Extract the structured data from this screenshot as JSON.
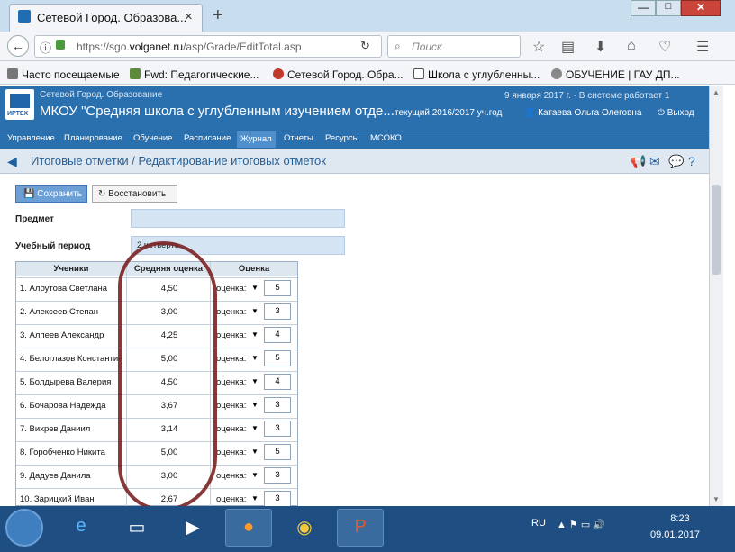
{
  "browser": {
    "tab_title": "Сетевой Город. Образова...",
    "tab_close": "×",
    "new_tab": "+",
    "url_prefix": "https://sgo.",
    "url_domain": "volganet.ru",
    "url_path": "/asp/Grade/EditTotal.asp",
    "search_placeholder": "Поиск",
    "window_min": "—",
    "window_max": "□",
    "window_close": "✕"
  },
  "bookmarks": [
    {
      "label": "Часто посещаемые",
      "icon": "bookmark-star-icon"
    },
    {
      "label": "Fwd: Педагогические...",
      "icon": "mail-icon"
    },
    {
      "label": "Сетевой Город. Обра...",
      "icon": "site-icon"
    },
    {
      "label": "Школа с углубленны...",
      "icon": "page-icon"
    },
    {
      "label": "ОБУЧЕНИЕ | ГАУ ДП...",
      "icon": "globe-icon"
    }
  ],
  "header": {
    "system_name": "Сетевой Город. Образование",
    "school": "МКОУ \"Средняя школа с углубленным изучением отде...",
    "date_line": "9 января 2017 г. - В системе работает 1",
    "year_line": "текущий 2016/2017 уч.год",
    "user": "Катаева Ольга Олеговна",
    "exit": "Выход",
    "logo_text": "ИРТЕХ"
  },
  "menu": [
    "Управление",
    "Планирование",
    "Обучение",
    "Расписание",
    "Журнал",
    "Отчеты",
    "Ресурсы",
    "МСОКО"
  ],
  "menu_active": "Журнал",
  "page": {
    "title": "Итоговые отметки / Редактирование итоговых отметок",
    "save_label": "Сохранить",
    "restore_label": "Восстановить",
    "subject_label": "Предмет",
    "subject_value": "",
    "period_label": "Учебный период",
    "period_value": "2 четверть"
  },
  "table": {
    "headers": [
      "Ученики",
      "Средняя оценка",
      "Оценка"
    ],
    "rows": [
      {
        "name": "1. Албутова Светлана",
        "avg": "4,50",
        "select": "оценка:",
        "grade": "5"
      },
      {
        "name": "2. Алексеев Степан",
        "avg": "3,00",
        "select": "оценка:",
        "grade": "3"
      },
      {
        "name": "3. Алпеев Александр",
        "avg": "4,25",
        "select": "оценка:",
        "grade": "4"
      },
      {
        "name": "4. Белоглазов Константин",
        "avg": "5,00",
        "select": "оценка:",
        "grade": "5"
      },
      {
        "name": "5. Болдырева Валерия",
        "avg": "4,50",
        "select": "оценка:",
        "grade": "4"
      },
      {
        "name": "6. Бочарова Надежда",
        "avg": "3,67",
        "select": "оценка:",
        "grade": "3"
      },
      {
        "name": "7. Вихрев Даниил",
        "avg": "3,14",
        "select": "оценка:",
        "grade": "3"
      },
      {
        "name": "8. Горобченко Никита",
        "avg": "5,00",
        "select": "оценка:",
        "grade": "5"
      },
      {
        "name": "9. Дадуев Данила",
        "avg": "3,00",
        "select": "оценка:",
        "grade": "3"
      },
      {
        "name": "10. Зарицкий Иван",
        "avg": "2,67",
        "select": "оценка:",
        "grade": "3"
      }
    ]
  },
  "taskbar": {
    "lang": "RU",
    "time": "8:23",
    "date": "09.01.2017"
  },
  "colors": {
    "header_blue": "#2a6fae",
    "annotation": "#7a2222"
  }
}
